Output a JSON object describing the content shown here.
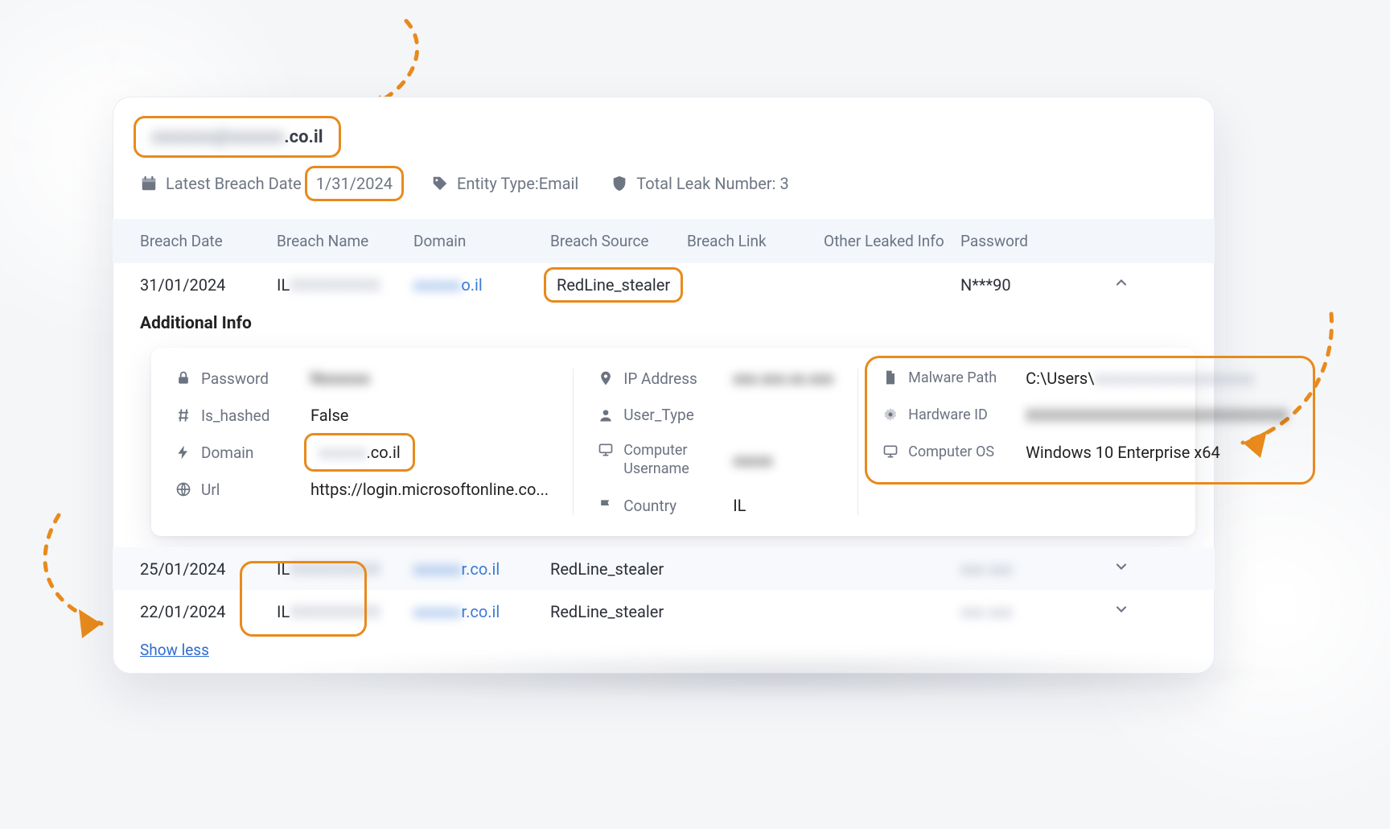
{
  "header": {
    "email_blur_prefix": "xxxxxxx@xxxxxx",
    "email_suffix": ".co.il",
    "latest_breach_label": "Latest Breach Date",
    "latest_breach_value": "1/31/2024",
    "entity_type_label": "Entity Type:",
    "entity_type_value": "Email",
    "total_leak_label": "Total Leak Number:",
    "total_leak_value": "3"
  },
  "columns": {
    "breach_date": "Breach Date",
    "breach_name": "Breach Name",
    "domain": "Domain",
    "breach_source": "Breach Source",
    "breach_link": "Breach Link",
    "other_leaked": "Other Leaked Info",
    "password": "Password"
  },
  "rows": [
    {
      "date": "31/01/2024",
      "name_prefix": "IL",
      "name_blur": "XXXXXXXXX",
      "domain_blur": "xxxxxx",
      "domain_suffix": "o.il",
      "source": "RedLine_stealer",
      "password": "N***90",
      "expanded": true
    },
    {
      "date": "25/01/2024",
      "name_prefix": "IL",
      "name_blur": "XXXXXXXXX",
      "domain_blur": "xxxxxx",
      "domain_suffix": "r.co.il",
      "source": "RedLine_stealer",
      "password": "xxx xxx",
      "expanded": false
    },
    {
      "date": "22/01/2024",
      "name_prefix": "IL",
      "name_blur": "XXXXXXXXX",
      "domain_blur": "xxxxxx",
      "domain_suffix": "r.co.il",
      "source": "RedLine_stealer",
      "password": "xxx xxx",
      "expanded": false
    }
  ],
  "additional_title": "Additional Info",
  "detail": {
    "password_label": "Password",
    "password_blur": "Nxxxxxx",
    "is_hashed_label": "Is_hashed",
    "is_hashed_value": "False",
    "domain_label": "Domain",
    "domain_blur": "xxxxxx",
    "domain_suffix": ".co.il",
    "url_label": "Url",
    "url_value": "https://login.microsoftonline.co...",
    "ip_label": "IP Address",
    "ip_blur": "xxx.xxx.xx.xxx",
    "user_type_label": "User_Type",
    "computer_username_label": "Computer Username",
    "computer_username_blur": "xxxxx",
    "country_label": "Country",
    "country_value": "IL",
    "malware_path_label": "Malware Path",
    "malware_path_prefix": "C:\\Users\\",
    "malware_path_blur": "xxxxxxxxxxxxxxxxxxxx",
    "hardware_id_label": "Hardware ID",
    "hardware_id_blur": "XXXXXXXXXXXXXXXXXXXXXXXXXX",
    "computer_os_label": "Computer OS",
    "computer_os_value": "Windows 10 Enterprise x64"
  },
  "show_less": "Show less",
  "icons": {
    "calendar": "calendar-icon",
    "tag": "tag-icon",
    "shield": "shield-icon",
    "lock": "lock-icon",
    "hash": "hash-icon",
    "bolt": "bolt-icon",
    "globe": "globe-icon",
    "pin": "pin-icon",
    "user": "user-icon",
    "monitor": "monitor-icon",
    "flag": "flag-icon",
    "file": "file-icon",
    "cog": "cog-icon",
    "chev_up": "▲",
    "chev_down": "▼"
  }
}
